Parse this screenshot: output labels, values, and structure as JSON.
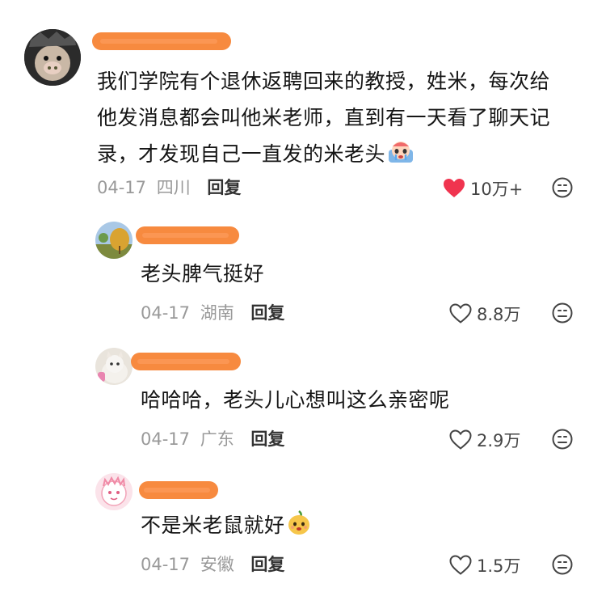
{
  "comments": [
    {
      "text_line1": "我们学院有个退休返聘回来的教授，姓米，每次给",
      "text_line2": "他发消息都会叫他米老师，直到有一天看了聊天记",
      "text_line3": "录，才发现自己一直发的米老头",
      "date": "04-17",
      "location": "四川",
      "reply_label": "回复",
      "likes": "10万+",
      "liked": true
    },
    {
      "text": "老头脾气挺好",
      "date": "04-17",
      "location": "湖南",
      "reply_label": "回复",
      "likes": "8.8万",
      "liked": false
    },
    {
      "text": "哈哈哈，老头儿心想叫这么亲密呢",
      "date": "04-17",
      "location": "广东",
      "reply_label": "回复",
      "likes": "2.9万",
      "liked": false
    },
    {
      "text": "不是米老鼠就好",
      "date": "04-17",
      "location": "安徽",
      "reply_label": "回复",
      "likes": "1.5万",
      "liked": false
    }
  ],
  "icons": {
    "like_filled": "heart-filled-icon",
    "like_outline": "heart-outline-icon",
    "more": "meh-face-icon",
    "emoji_cry": "crying-emoji-icon",
    "emoji_mango": "mango-emoji-icon"
  },
  "colors": {
    "heart": "#f0344f",
    "redact": "#f78a3f",
    "meta": "#999999"
  }
}
